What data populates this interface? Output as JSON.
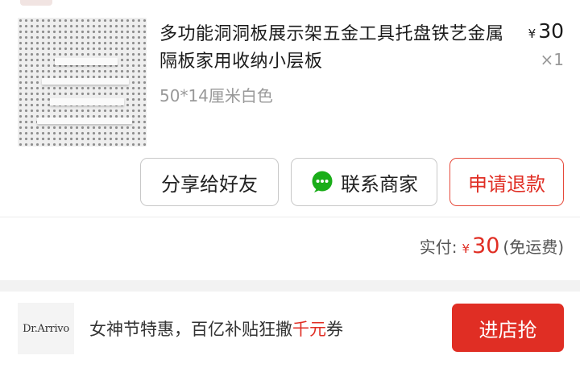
{
  "order_item": {
    "title": "多功能洞洞板展示架五金工具托盘铁艺金属隔板家用收纳小层板",
    "spec": "50*14厘米白色",
    "price_symbol": "¥",
    "price": "30",
    "quantity": "×1"
  },
  "actions": {
    "share_label": "分享给好友",
    "contact_label": "联系商家",
    "refund_label": "申请退款"
  },
  "payment": {
    "label": "实付:",
    "symbol": "¥",
    "amount": "30",
    "note": "(免运费)"
  },
  "promo": {
    "brand_name": "Dr.Arrivo",
    "text": "女神节特惠，百亿补贴狂撒",
    "highlight": "千元",
    "text_suffix": "券",
    "cta_label": "进店抢"
  },
  "colors": {
    "accent_red": "#e02e24",
    "wechat_green": "#1aad19"
  },
  "icons": {
    "contact": "wechat-chat-icon"
  }
}
